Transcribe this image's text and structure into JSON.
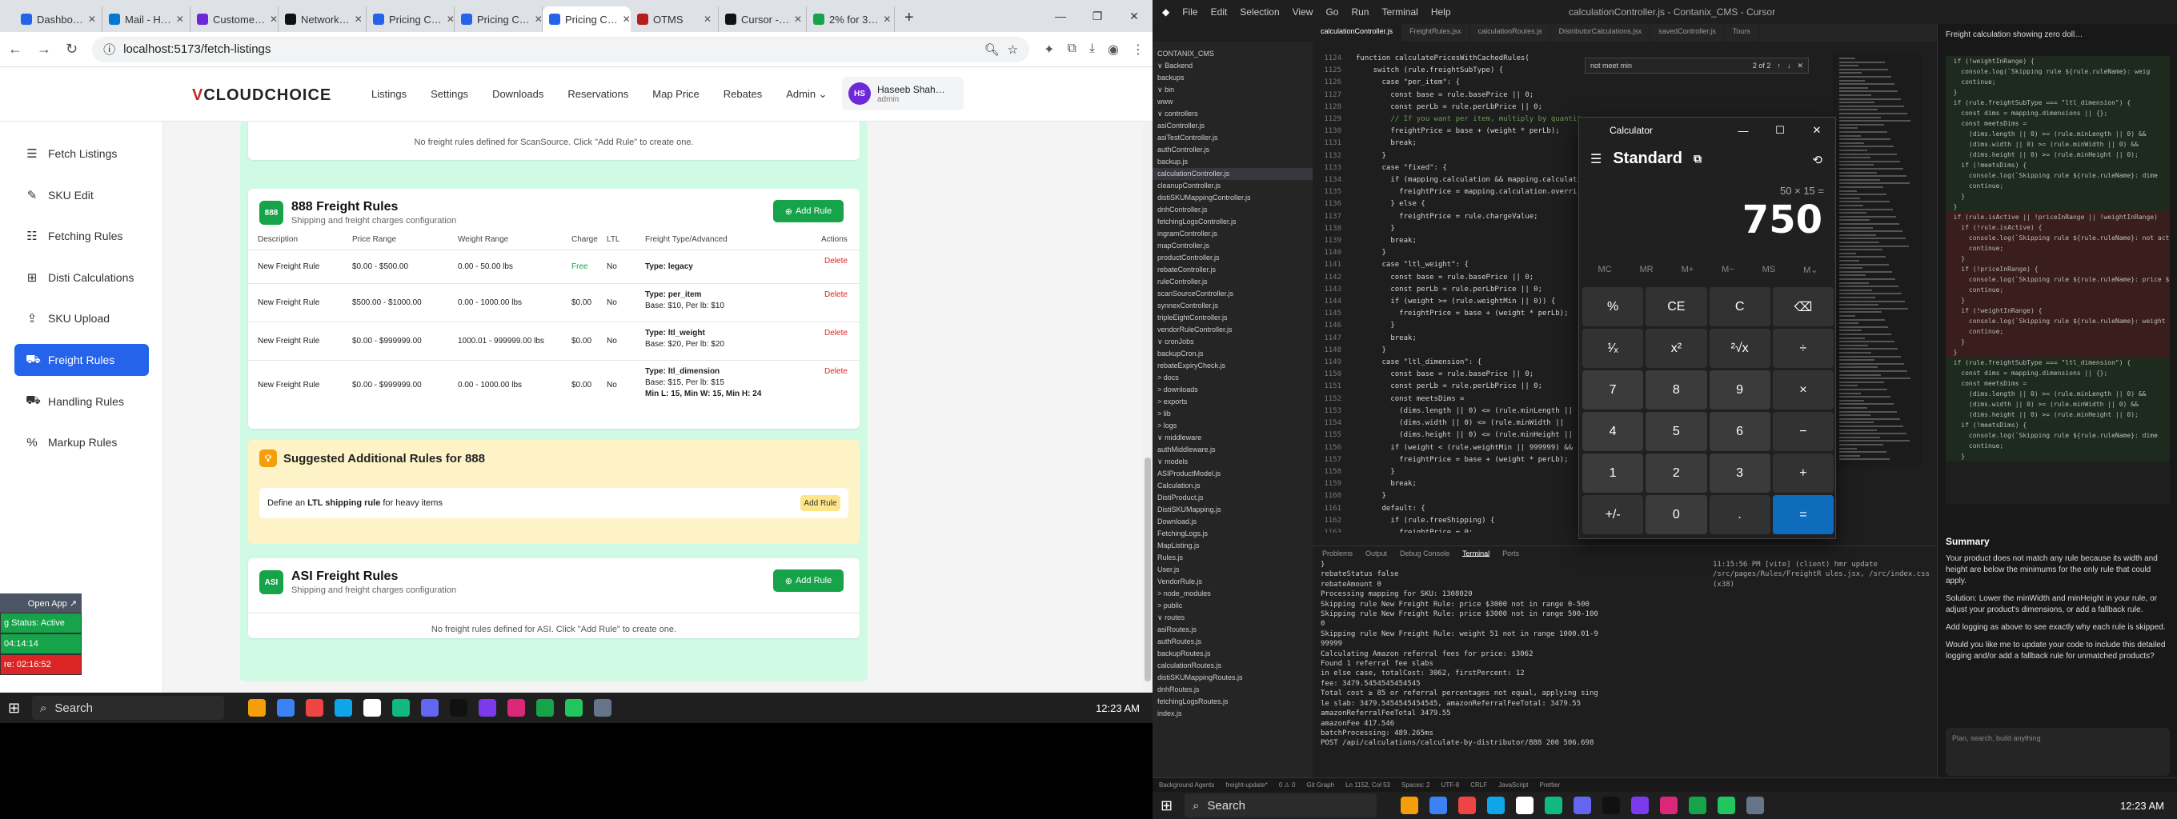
{
  "browser": {
    "tabs": [
      {
        "label": "Dashbo…",
        "color": "#2563eb"
      },
      {
        "label": "Mail - H…",
        "color": "#0078d4"
      },
      {
        "label": "Custome…",
        "color": "#6d28d9"
      },
      {
        "label": "Network…",
        "color": "#111"
      },
      {
        "label": "Pricing C…",
        "color": "#2563eb"
      },
      {
        "label": "Pricing C…",
        "color": "#2563eb"
      },
      {
        "label": "Pricing C…",
        "color": "#2563eb",
        "active": true
      },
      {
        "label": "OTMS",
        "color": "#b91c1c"
      },
      {
        "label": "Cursor -…",
        "color": "#111"
      },
      {
        "label": "2% for 3…",
        "color": "#16a34a"
      }
    ],
    "url": "localhost:5173/fetch-listings"
  },
  "app": {
    "logo_prefix": "V",
    "logo_main": "CLOUDCHOICE",
    "nav": [
      "Listings",
      "Settings",
      "Downloads",
      "Reservations",
      "Map Price",
      "Rebates",
      "Admin ⌄"
    ],
    "user_initials": "HS",
    "user_name": "Haseeb Shah…",
    "user_role": "admin"
  },
  "sidebar": [
    {
      "label": "Fetch Listings",
      "icon": "☰"
    },
    {
      "label": "SKU Edit",
      "icon": "✎"
    },
    {
      "label": "Fetching Rules",
      "icon": "☷"
    },
    {
      "label": "Disti Calculations",
      "icon": "⊞"
    },
    {
      "label": "SKU Upload",
      "icon": "⇪"
    },
    {
      "label": "Freight Rules",
      "icon": "⛟",
      "active": true
    },
    {
      "label": "Handling Rules",
      "icon": "⛟"
    },
    {
      "label": "Markup Rules",
      "icon": "%"
    }
  ],
  "scansource_empty": "No freight rules defined for ScanSource. Click \"Add Rule\" to create one.",
  "card888": {
    "badge": "888",
    "title": "888 Freight Rules",
    "subtitle": "Shipping and freight charges configuration",
    "add": "Add Rule",
    "headers": [
      "Description",
      "Price Range",
      "Weight Range",
      "Charge",
      "LTL",
      "Freight Type/Advanced",
      "Actions"
    ],
    "rows": [
      {
        "desc": "New Freight Rule",
        "price": "$0.00 - $500.00",
        "weight": "0.00 - 50.00 lbs",
        "charge": "Free",
        "ltl": "No",
        "type": "Type: legacy",
        "adv": "",
        "adv2": "",
        "del": "Delete"
      },
      {
        "desc": "New Freight Rule",
        "price": "$500.00 - $1000.00",
        "weight": "0.00 - 1000.00 lbs",
        "charge": "$0.00",
        "ltl": "No",
        "type": "Type: per_item",
        "adv": "Base: $10, Per lb: $10",
        "adv2": "",
        "del": "Delete"
      },
      {
        "desc": "New Freight Rule",
        "price": "$0.00 - $999999.00",
        "weight": "1000.01 - 999999.00 lbs",
        "charge": "$0.00",
        "ltl": "No",
        "type": "Type: ltl_weight",
        "adv": "Base: $20, Per lb: $20",
        "adv2": "",
        "del": "Delete"
      },
      {
        "desc": "New Freight Rule",
        "price": "$0.00 - $999999.00",
        "weight": "0.00 - 1000.00 lbs",
        "charge": "$0.00",
        "ltl": "No",
        "type": "Type: ltl_dimension",
        "adv": "Base: $15, Per lb: $15",
        "adv2": "Min L: 15, Min W: 15, Min H: 24",
        "del": "Delete"
      }
    ]
  },
  "suggest": {
    "title": "Suggested Additional Rules for 888",
    "pre": "Define an ",
    "bold": "LTL shipping rule",
    "post": " for heavy items",
    "btn": "Add Rule"
  },
  "asi": {
    "badge": "ASI",
    "title": "ASI Freight Rules",
    "subtitle": "Shipping and freight charges configuration",
    "add": "Add Rule",
    "empty": "No freight rules defined for ASI. Click \"Add Rule\" to create one."
  },
  "widget": {
    "open": "Open App ↗",
    "status": "g Status: Active",
    "t1": "04:14:14",
    "t2": "re: 02:16:52"
  },
  "taskbar": {
    "search": "Search",
    "time": "12:23 AM"
  },
  "vscode": {
    "menu": [
      "File",
      "Edit",
      "Selection",
      "View",
      "Go",
      "Run",
      "Terminal",
      "Help"
    ],
    "title": "calculationController.js - Contanix_CMS - Cursor",
    "tabs": [
      "calculationController.js",
      "FreightRules.jsx",
      "calculationRoutes.js",
      "DistributorCalculations.jsx",
      "savedController.js",
      "Tours"
    ],
    "find": "not meet min",
    "find_count": "2 of 2",
    "explorer": [
      "CONTANIX_CMS",
      "∨ Backend",
      "  backups",
      "∨ bin",
      "   www",
      "∨ controllers",
      "   asiController.js",
      "   asiTestController.js",
      "   authController.js",
      "   backup.js",
      "   calculationController.js",
      "   cleanupController.js",
      "   distiSKUMappingController.js",
      "   dnhController.js",
      "   fetchingLogsController.js",
      "   ingramController.js",
      "   mapController.js",
      "   productController.js",
      "   rebateController.js",
      "   ruleController.js",
      "   scanSourceController.js",
      "   synnexController.js",
      "   tripleEightController.js",
      "   vendorRuleController.js",
      "∨ cronJobs",
      "   backupCron.js",
      "   rebateExpiryCheck.js",
      "> docs",
      "> downloads",
      "> exports",
      "> lib",
      "> logs",
      "∨ middleware",
      "   authMiddleware.js",
      "∨ models",
      "   ASIProductModel.js",
      "   Calculation.js",
      "   DistiProduct.js",
      "   DistiSKUMapping.js",
      "   Download.js",
      "   FetchingLogs.js",
      "   MapListing.js",
      "   Rules.js",
      "   User.js",
      "   VendorRule.js",
      "> node_modules",
      "> public",
      "∨ routes",
      "   asiRoutes.js",
      "   authRoutes.js",
      "   backupRoutes.js",
      "   calculationRoutes.js",
      "   distiSKUMappingRoutes.js",
      "   dnhRoutes.js",
      "   fetchingLogsRoutes.js",
      "   index.js"
    ],
    "code": [
      "function calculatePricesWithCachedRules(",
      "    switch (rule.freightSubType) {",
      "      case \"per_item\": {",
      "        const base = rule.basePrice || 0;",
      "        const perLb = rule.perLbPrice || 0;",
      "        // If you want per item, multiply by quantity",
      "        freightPrice = base + (weight * perLb);",
      "        break;",
      "      }",
      "      case \"fixed\": {",
      "        if (mapping.calculation && mapping.calculation",
      "          freightPrice = mapping.calculation.overri",
      "        } else {",
      "          freightPrice = rule.chargeValue;",
      "        }",
      "        break;",
      "      }",
      "      case \"ltl_weight\": {",
      "        const base = rule.basePrice || 0;",
      "        const perLb = rule.perLbPrice || 0;",
      "        if (weight >= (rule.weightMin || 0)) {",
      "          freightPrice = base + (weight * perLb);",
      "        }",
      "        break;",
      "      }",
      "      case \"ltl_dimension\": {",
      "        const base = rule.basePrice || 0;",
      "        const perLb = rule.perLbPrice || 0;",
      "        const meetsDims =",
      "          (dims.length || 0) <= (rule.minLength ||",
      "          (dims.width || 0) <= (rule.minWidth ||",
      "          (dims.height || 0) <= (rule.minHeight ||",
      "        if (weight < (rule.weightMin || 999999) &&",
      "          freightPrice = base + (weight * perLb);",
      "        }",
      "        break;",
      "      }",
      "      default: {",
      "        if (rule.freeShipping) {",
      "          freightPrice = 0;",
      "          break;",
      "        }",
      "        if (rule.chargeType === \"fixed\") {",
      "          freightPrice = rule.chargeValue;",
      "        } else if (rule.chargeType === \"percentage\""
    ],
    "line_start": "1124",
    "panel_tabs": [
      "Problems",
      "Output",
      "Debug Console",
      "Terminal",
      "Ports"
    ],
    "terminal": [
      "}",
      "rebateStatus false",
      "rebateAmount 0",
      "",
      "Processing mapping for SKU: 1308020",
      "Skipping rule New Freight Rule: price $3000 not in range 0-500",
      "Skipping rule New Freight Rule: price $3000 not in range 500-100",
      "0",
      "Skipping rule New Freight Rule: weight 51 not in range 1000.01-9",
      "99999",
      "",
      "Calculating Amazon referral fees for price: $3062",
      "Found 1 referral fee slabs",
      "in else case, totalCost: 3062, firstPercent: 12",
      "fee: 3479.5454545454545",
      "Total cost ≥ 85 or referral percentages not equal, applying sing",
      "le slab: 3479.5454545454545, amazonReferralFeeTotal: 3479.55",
      "amazonReferralFeeTotal 3479.55",
      "amazonFee 417.546",
      "batchProcessing: 489.265ms",
      "POST /api/calculations/calculate-by-distributor/888 200 506.698"
    ],
    "vite": "11:15:56 PM [vite] (client) hmr update /src/pages/Rules/FreightR ules.jsx, /src/index.css (x38)",
    "chat_title": "Freight calculation showing zero doll…",
    "chat_code": [
      "  if (!weightInRange) {",
      "    console.log(`Skipping rule ${rule.ruleName}: weig",
      "    continue;",
      "  }",
      "",
      "  if (rule.freightSubType === \"ltl_dimension\") {",
      "    const dims = mapping.dimensions || {};",
      "    const meetsDims =",
      "      (dims.length || 0) >= (rule.minLength || 0) &&",
      "      (dims.width || 0) >= (rule.minWidth || 0) &&",
      "      (dims.height || 0) >= (rule.minHeight || 0);",
      "    if (!meetsDims) {",
      "      console.log(`Skipping rule ${rule.ruleName}: dime",
      "      continue;",
      "    }",
      "  }",
      "",
      "  if (rule.isActive || !priceInRange || !weightInRange)",
      "    if (!rule.isActive) {",
      "      console.log(`Skipping rule ${rule.ruleName}: not act",
      "      continue;",
      "    }",
      "    if (!priceInRange) {",
      "      console.log(`Skipping rule ${rule.ruleName}: price $",
      "      continue;",
      "    }",
      "    if (!weightInRange) {",
      "      console.log(`Skipping rule ${rule.ruleName}: weight",
      "      continue;",
      "    }",
      "  }",
      "  if (rule.freightSubType === \"ltl_dimension\") {",
      "    const dims = mapping.dimensions || {};",
      "    const meetsDims =",
      "      (dims.length || 0) >= (rule.minLength || 0) &&",
      "      (dims.width || 0) >= (rule.minWidth || 0) &&",
      "      (dims.height || 0) >= (rule.minHeight || 0);",
      "    if (!meetsDims) {",
      "      console.log(`Skipping rule ${rule.ruleName}: dime",
      "      continue;",
      "    }"
    ],
    "summary_title": "Summary",
    "summary": [
      "Your product does not match any rule because its width and height are below the minimums for the only rule that could apply.",
      "Solution: Lower the minWidth and minHeight in your rule, or adjust your product's dimensions, or add a fallback rule.",
      "Add logging as above to see exactly why each rule is skipped.",
      "Would you like me to update your code to include this detailed logging and/or add a fallback rule for unmatched products?"
    ],
    "chat_placeholder": "Plan, search, build anything",
    "status": [
      "Background Agents",
      "freight-update*",
      "0 ⚠ 0",
      "Git Graph",
      "Ln 1152, Col 53",
      "Spaces: 2",
      "UTF-8",
      "CRLF",
      "JavaScript",
      "Prettier"
    ]
  },
  "calculator": {
    "title": "Calculator",
    "mode": "Standard",
    "expression": "50 × 15 =",
    "display": "750",
    "memory": [
      "MC",
      "MR",
      "M+",
      "M−",
      "MS",
      "M⌄"
    ],
    "keys": [
      "%",
      "CE",
      "C",
      "⌫",
      "¹⁄ₓ",
      "x²",
      "²√x",
      "÷",
      "7",
      "8",
      "9",
      "×",
      "4",
      "5",
      "6",
      "−",
      "1",
      "2",
      "3",
      "+",
      "+/-",
      "0",
      ".",
      "="
    ]
  }
}
